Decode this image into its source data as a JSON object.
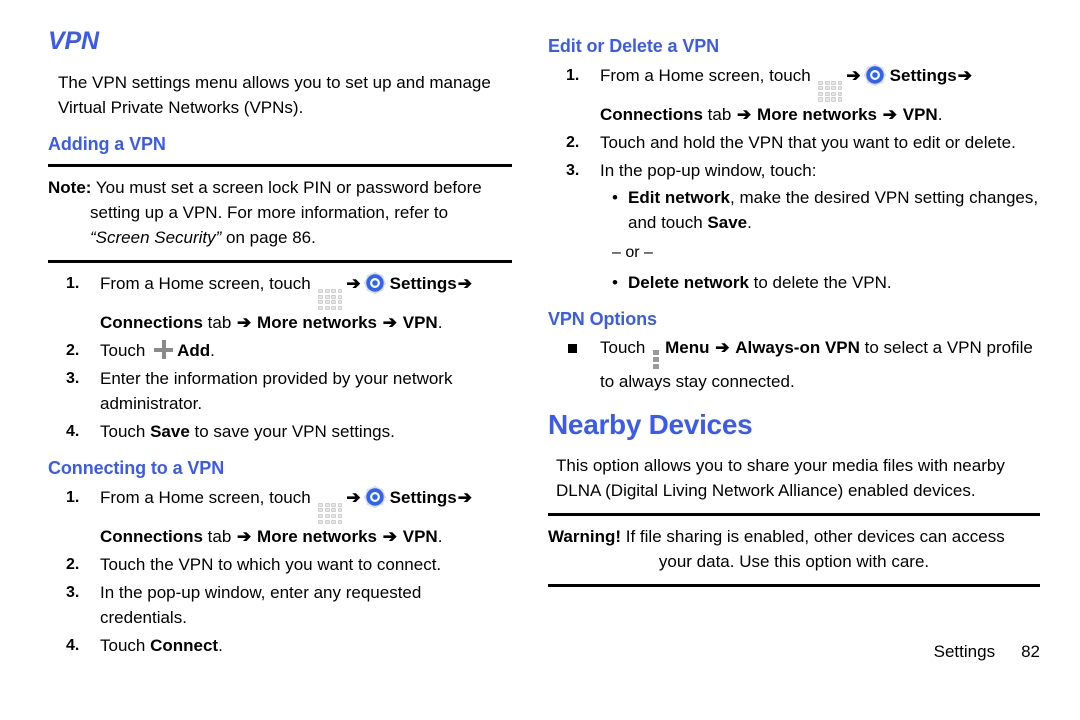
{
  "left": {
    "title": "VPN",
    "intro": "The VPN settings menu allows you to set up and manage Virtual Private Networks (VPNs).",
    "adding": {
      "heading": "Adding a VPN",
      "note": {
        "label": "Note:",
        "line1": "You must set a screen lock PIN or password before",
        "line2_pre": "setting up a VPN. For more information, refer to ",
        "line2_italic": "“Screen Security”",
        "line2_post": " on page 86."
      },
      "steps": [
        {
          "num": "1.",
          "pre": "From a Home screen, touch ",
          "icon_apps": "apps-grid-icon",
          "arrow1": "➔",
          "icon_gear": "settings-gear-icon",
          "settings": "Settings",
          "arrow2": "➔",
          "connections": "Connections",
          "tab": " tab ",
          "arrow3": "➔",
          "more_networks": "More networks",
          "arrow4": "➔",
          "vpn": "VPN",
          "period": "."
        },
        {
          "num": "2.",
          "pre": "Touch ",
          "icon_plus": "plus-icon",
          "bold": "Add",
          "post": "."
        },
        {
          "num": "3.",
          "text": "Enter the information provided by your network administrator."
        },
        {
          "num": "4.",
          "pre": "Touch ",
          "bold": "Save",
          "post": " to save your VPN settings."
        }
      ]
    },
    "connecting": {
      "heading": "Connecting to a VPN",
      "steps": [
        {
          "num": "1.",
          "pre": "From a Home screen, touch ",
          "icon_apps": "apps-grid-icon",
          "arrow1": "➔",
          "icon_gear": "settings-gear-icon",
          "settings": "Settings",
          "arrow2": "➔",
          "connections": "Connections",
          "tab": " tab ",
          "arrow3": "➔",
          "more_networks": "More networks",
          "arrow4": "➔",
          "vpn": "VPN",
          "period": "."
        },
        {
          "num": "2.",
          "text": "Touch the VPN to which you want to connect."
        },
        {
          "num": "3.",
          "text": "In the pop-up window, enter any requested credentials."
        },
        {
          "num": "4.",
          "pre": "Touch ",
          "bold": "Connect",
          "post": "."
        }
      ]
    }
  },
  "right": {
    "edit_delete": {
      "heading": "Edit or Delete a VPN",
      "step1": {
        "num": "1.",
        "pre": "From a Home screen, touch ",
        "icon_apps": "apps-grid-icon",
        "arrow1": "➔",
        "icon_gear": "settings-gear-icon",
        "settings": "Settings",
        "arrow2": "➔",
        "connections": "Connections",
        "tab": " tab ",
        "arrow3": "➔",
        "more_networks": "More networks",
        "arrow4": "➔",
        "vpn": "VPN",
        "period": "."
      },
      "step2": {
        "num": "2.",
        "text": "Touch and hold the VPN that you want to edit or delete."
      },
      "step3": {
        "num": "3.",
        "text": "In the pop-up window, touch:"
      },
      "sub": {
        "bullet1": {
          "dot": "•",
          "bold": "Edit network",
          "text": ", make the desired VPN setting changes, and touch ",
          "bold2": "Save",
          "post": "."
        },
        "or": "– or –",
        "bullet2": {
          "dot": "•",
          "bold": "Delete network",
          "text": " to delete the VPN."
        }
      }
    },
    "vpn_options": {
      "heading": "VPN Options",
      "bullet": {
        "pre": "Touch ",
        "icon_menu": "menu-kebab-icon",
        "menu": "Menu",
        "arrow": "➔",
        "always_on": "Always-on VPN",
        "post": " to select a VPN profile to always stay connected."
      }
    },
    "nearby_devices": {
      "heading": "Nearby Devices",
      "intro": "This option allows you to share your media files with nearby DLNA (Digital Living Network Alliance) enabled devices.",
      "warning": {
        "label": "Warning!",
        "line1": "If file sharing is enabled, other devices can access",
        "line2": "your data. Use this option with care."
      }
    }
  },
  "footer": {
    "section": "Settings",
    "page": "82"
  },
  "colors": {
    "heading_blue": "#3b5bf0",
    "text_black": "#000000",
    "icon_gray": "#9a9a9a",
    "apps_icon_gray": "#e6e6e6"
  }
}
